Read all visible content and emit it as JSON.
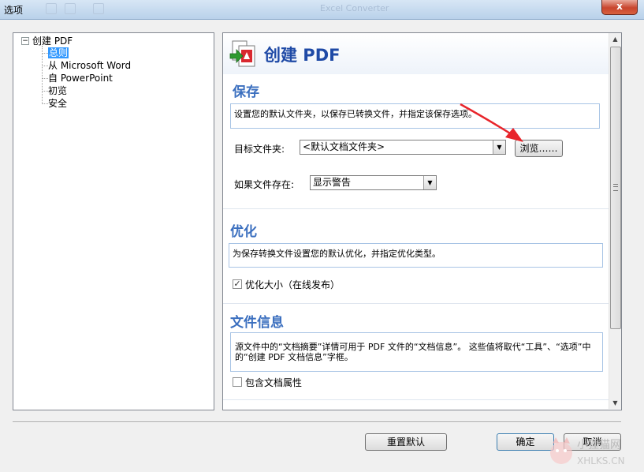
{
  "window": {
    "title": "选项",
    "faint_title": "Excel Converter",
    "close_label": "x"
  },
  "tree": {
    "expander": "−",
    "root": "创建 PDF",
    "items": [
      "总则",
      "从 Microsoft Word",
      "自 PowerPoint",
      "初览",
      "安全"
    ],
    "selected_index": 0
  },
  "content": {
    "page_title": "创建 PDF",
    "save": {
      "title": "保存",
      "description": "设置您的默认文件夹，以保存已转换文件，并指定该保存选项。",
      "target_folder_label": "目标文件夹:",
      "target_folder_value": "<默认文档文件夹>",
      "browse_label": "浏览……",
      "if_exists_label": "如果文件存在:",
      "if_exists_value": "显示警告"
    },
    "optimize": {
      "title": "优化",
      "description": "为保存转换文件设置您的默认优化，并指定优化类型。",
      "checkbox_label": "优化大小（在线发布）",
      "checked": true
    },
    "docinfo": {
      "title": "文件信息",
      "description": "源文件中的“文档摘要”详情可用于 PDF 文件的“文档信息”。 这些值将取代“工具”、“选项”中的“创建 PDF 文档信息”字框。",
      "checkbox_label": "包含文档属性",
      "checked": false
    }
  },
  "buttons": {
    "reset": "重置默认",
    "ok": "确定",
    "cancel": "取消"
  },
  "watermark": {
    "line1": "小狸猫网",
    "line2": "XHLKS.CN"
  },
  "colors": {
    "accent_blue": "#1f4aa6",
    "section_blue": "#3b6fbf",
    "annotation_red": "#e8252b"
  }
}
